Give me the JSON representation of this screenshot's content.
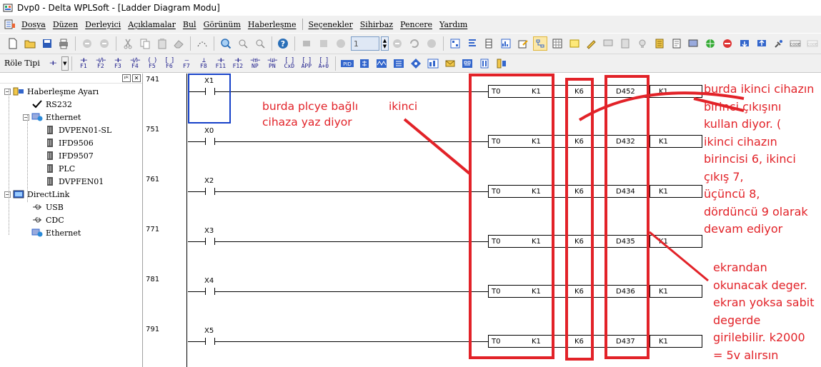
{
  "window": {
    "title": "Dvp0 - Delta WPLSoft - [Ladder Diagram Modu]"
  },
  "menu": {
    "items": [
      "Dosya",
      "Düzen",
      "Derleyici",
      "Açıklamalar",
      "Bul",
      "Görünüm",
      "Haberleşme",
      "Seçenekler",
      "Sihirbaz",
      "Pencere",
      "Yardım"
    ]
  },
  "toolbar": {
    "step_value": "1",
    "relay_type_label": "Röle Tipi",
    "function_keys": [
      {
        "sym": "⊣⊢",
        "key": "F1"
      },
      {
        "sym": "⊣/⊢",
        "key": "F2"
      },
      {
        "sym": "⊣⊢",
        "key": "F3"
      },
      {
        "sym": "⊣/⊢",
        "key": "F4"
      },
      {
        "sym": "( )",
        "key": "F5"
      },
      {
        "sym": "[ ]",
        "key": "F6"
      },
      {
        "sym": "—",
        "key": "F7"
      },
      {
        "sym": "⊥",
        "key": "F8"
      },
      {
        "sym": "⊣⊢",
        "key": "F11"
      },
      {
        "sym": "⊣⊢",
        "key": "F12"
      },
      {
        "sym": "⊣↑⊢",
        "key": "NP"
      },
      {
        "sym": "⊣↓⊢",
        "key": "PN"
      },
      {
        "sym": "[ ]",
        "key": "CxD"
      },
      {
        "sym": "[ ]",
        "key": "APP"
      },
      {
        "sym": "[ ]",
        "key": "A+0"
      }
    ]
  },
  "sidebar": {
    "tree": [
      {
        "label": "Haberleşme Ayarı",
        "level": 0,
        "expander": "−",
        "icon": "network-settings-icon"
      },
      {
        "label": "RS232",
        "level": 1,
        "expander": "",
        "icon": "check-icon"
      },
      {
        "label": "Ethernet",
        "level": 1,
        "expander": "−",
        "icon": "ethernet-globe-icon"
      },
      {
        "label": "DVPEN01-SL",
        "level": 2,
        "expander": "",
        "icon": "device-module-icon"
      },
      {
        "label": "IFD9506",
        "level": 2,
        "expander": "",
        "icon": "device-module-icon"
      },
      {
        "label": "IFD9507",
        "level": 2,
        "expander": "",
        "icon": "device-module-icon"
      },
      {
        "label": "PLC",
        "level": 2,
        "expander": "",
        "icon": "device-module-icon"
      },
      {
        "label": "DVPFEN01",
        "level": 2,
        "expander": "",
        "icon": "device-module-icon"
      },
      {
        "label": "DirectLink",
        "level": 0,
        "expander": "−",
        "icon": "directlink-icon"
      },
      {
        "label": "USB",
        "level": 1,
        "expander": "",
        "icon": "usb-icon"
      },
      {
        "label": "CDC",
        "level": 1,
        "expander": "",
        "icon": "usb-icon"
      },
      {
        "label": "Ethernet",
        "level": 1,
        "expander": "",
        "icon": "ethernet-globe-icon"
      }
    ]
  },
  "ladder": {
    "rungs": [
      {
        "step": "741",
        "contact": "X1",
        "ops": [
          "T0",
          "K1",
          "K6",
          "D452",
          "K1"
        ]
      },
      {
        "step": "751",
        "contact": "X0",
        "ops": [
          "T0",
          "K1",
          "K6",
          "D432",
          "K1"
        ]
      },
      {
        "step": "761",
        "contact": "X2",
        "ops": [
          "T0",
          "K1",
          "K6",
          "D434",
          "K1"
        ]
      },
      {
        "step": "771",
        "contact": "X3",
        "ops": [
          "T0",
          "K1",
          "K6",
          "D435",
          "K1"
        ]
      },
      {
        "step": "781",
        "contact": "X4",
        "ops": [
          "T0",
          "K1",
          "K6",
          "D436",
          "K1"
        ]
      },
      {
        "step": "791",
        "contact": "X5",
        "ops": [
          "T0",
          "K1",
          "K6",
          "D437",
          "K1"
        ]
      }
    ]
  },
  "annotations": {
    "plc_note": "burda plcye bağlı\ncihaza yaz diyor",
    "second_note": "ikinci",
    "output_note": "burda ikinci cihazın\nbirinci çıkışını\nkullan diyor. (\nikinci cihazın\nbirincisi 6, ikinci\nçıkış 7,\nüçüncü 8,\ndördüncü 9 olarak\ndevam ediyor",
    "screen_note": "ekrandan\nokunacak deger.\nekran yoksa sabit\ndegerde\ngirilebilir. k2000\n= 5v alırsın",
    "color": "#e22228"
  },
  "colors": {
    "cursor": "#1540c8",
    "menu_bg": "#f0f0f0"
  }
}
